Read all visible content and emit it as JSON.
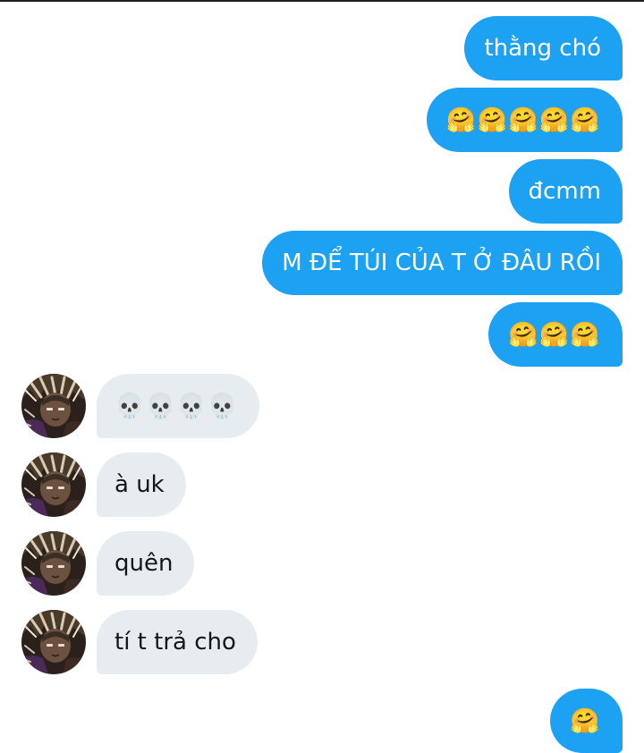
{
  "conversation": {
    "outgoing_color": "#1da1f2",
    "incoming_color": "#e6ecf0",
    "messages": [
      {
        "direction": "out",
        "text": "thằng chó"
      },
      {
        "direction": "out",
        "text": "🤗🤗🤗🤗🤗"
      },
      {
        "direction": "out",
        "text": "đcmm"
      },
      {
        "direction": "out",
        "text": "M ĐỂ TÚI CỦA T Ở ĐÂU RỒI"
      },
      {
        "direction": "out",
        "text": "🤗🤗🤗"
      },
      {
        "direction": "in",
        "text": "💀💀💀💀"
      },
      {
        "direction": "in",
        "text": "à uk"
      },
      {
        "direction": "in",
        "text": "quên"
      },
      {
        "direction": "in",
        "text": "tí t trả cho"
      },
      {
        "direction": "out",
        "text": "🤗"
      }
    ]
  },
  "icons": {
    "avatar": "anime-character-avatar"
  }
}
